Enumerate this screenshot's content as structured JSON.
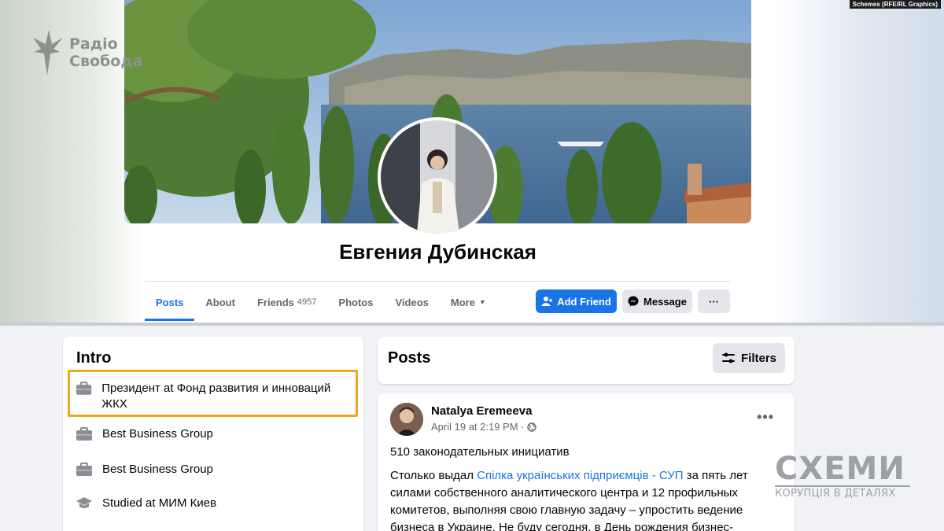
{
  "watermark": {
    "outlet_line1": "Радіо",
    "outlet_line2": "Свобода",
    "credit": "Schemes (RFE/RL Graphics)",
    "schemes_title": "СХЕМИ",
    "schemes_subtitle": "КОРУПЦІЯ В ДЕТАЛЯХ"
  },
  "profile": {
    "name": "Евгения Дубинская"
  },
  "tabs": [
    {
      "label": "Posts",
      "active": true
    },
    {
      "label": "About"
    },
    {
      "label": "Friends",
      "count": "4957"
    },
    {
      "label": "Photos"
    },
    {
      "label": "Videos"
    },
    {
      "label": "More"
    }
  ],
  "actions": {
    "add_friend": "Add Friend",
    "message": "Message",
    "more": "···"
  },
  "intro": {
    "title": "Intro",
    "items": [
      {
        "text": "Президент at Фонд развития и инноваций ЖКХ",
        "icon": "briefcase-icon"
      },
      {
        "text": "Best Business Group",
        "icon": "briefcase-icon"
      },
      {
        "text": "Best Business Group",
        "icon": "briefcase-icon"
      },
      {
        "text": "Studied at МИМ Киев",
        "icon": "graduation-cap-icon"
      }
    ]
  },
  "posts": {
    "title": "Posts",
    "filters_label": "Filters",
    "post": {
      "author": "Natalya Eremeeva",
      "date": "April 19 at 2:19 PM ·",
      "headline": "510 законодательных инициатив",
      "body_before_link": "Столько выдал ",
      "link_text": "Спілка українських підприємців - СУП",
      "body_after_link": " за пять лет силами собственного аналитического центра и 12 профильных комитетов, выполняя свою главную задачу – упростить ведение бизнеса в Украине. Не буду сегодня, в День рождения бизнес-"
    }
  },
  "colors": {
    "accent": "#1b74e4",
    "highlight_border": "#f0a820",
    "feed_background": "#f0f2f5"
  }
}
